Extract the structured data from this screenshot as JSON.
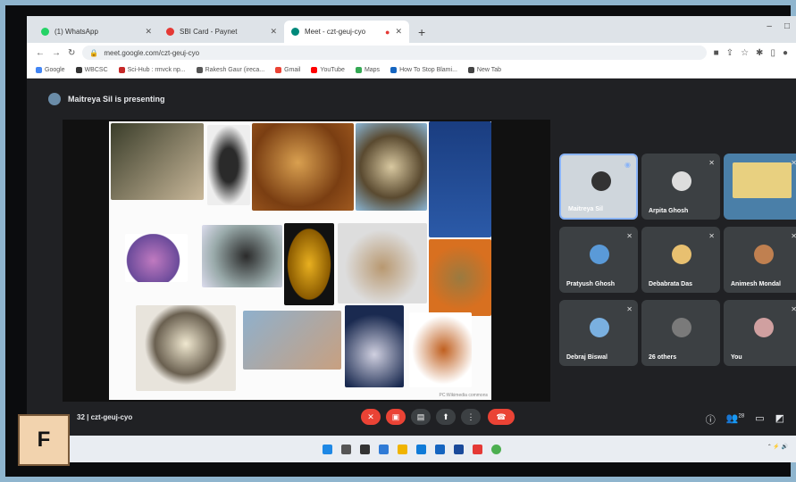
{
  "tabs": [
    {
      "label": "(1) WhatsApp",
      "color": "#25d366"
    },
    {
      "label": "SBI Card - Paynet",
      "color": "#1a5aa6"
    },
    {
      "label": "Meet - czt-geuj-cyo",
      "color": "#00897b"
    }
  ],
  "toolbar": {
    "url": "meet.google.com/czt-geuj-cyo"
  },
  "bookmarks": [
    "Google",
    "WBCSC",
    "Sci-Hub : rmvck np...",
    "Rakesh Gaur (ireca...",
    "Gmail",
    "YouTube",
    "Maps",
    "How To Stop Blami...",
    "New Tab"
  ],
  "meet": {
    "presenter": "Maitreya Sil is presenting",
    "credit": "PC:Wikimedia commons",
    "meeting_code": "32 | czt-geuj-cyo",
    "participants": [
      "Maitreya Sil",
      "Arpita Ghosh",
      "",
      "Pratyush Ghosh",
      "Debabrata Das",
      "Animesh Mondal",
      "Debraj Biswal",
      "26 others",
      "You"
    ],
    "participant_count": "28"
  },
  "badge": {
    "label": "F"
  }
}
